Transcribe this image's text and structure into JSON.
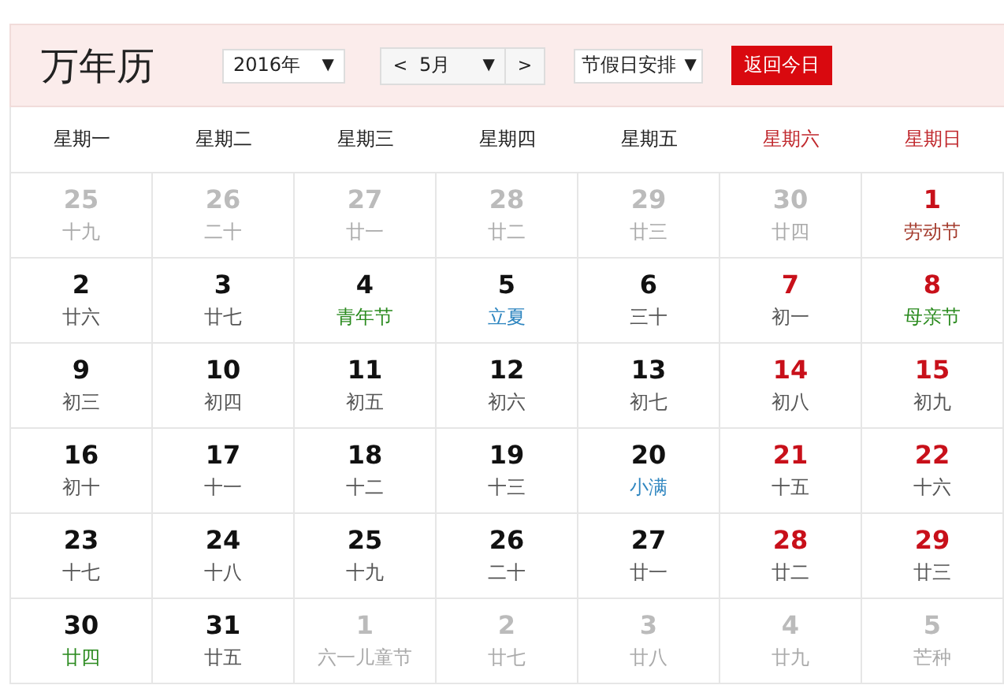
{
  "title": "万年历",
  "year_select": {
    "value": "2016年",
    "arrow": "▼"
  },
  "month_nav": {
    "prev": "<",
    "value": "5月",
    "arrow": "▼",
    "next": ">"
  },
  "holiday_select": {
    "value": "节假日安排",
    "arrow": "▼"
  },
  "today_button": "返回今日",
  "weekdays": [
    {
      "label": "星期一",
      "weekend": false
    },
    {
      "label": "星期二",
      "weekend": false
    },
    {
      "label": "星期三",
      "weekend": false
    },
    {
      "label": "星期四",
      "weekend": false
    },
    {
      "label": "星期五",
      "weekend": false
    },
    {
      "label": "星期六",
      "weekend": true
    },
    {
      "label": "星期日",
      "weekend": true
    }
  ],
  "weeks": [
    [
      {
        "day": "25",
        "kind": "other",
        "note": {
          "text": "十九",
          "color": "#aaaaaa"
        }
      },
      {
        "day": "26",
        "kind": "other",
        "note": {
          "text": "二十",
          "color": "#aaaaaa"
        }
      },
      {
        "day": "27",
        "kind": "other",
        "note": {
          "text": "廿一",
          "color": "#aaaaaa"
        }
      },
      {
        "day": "28",
        "kind": "other",
        "note": {
          "text": "廿二",
          "color": "#aaaaaa"
        }
      },
      {
        "day": "29",
        "kind": "other",
        "note": {
          "text": "廿三",
          "color": "#aaaaaa"
        }
      },
      {
        "day": "30",
        "kind": "other",
        "note": {
          "text": "廿四",
          "color": "#aaaaaa"
        }
      },
      {
        "day": "1",
        "kind": "weekend",
        "note": {
          "text": "劳动节",
          "color": "#a33a2c"
        }
      }
    ],
    [
      {
        "day": "2",
        "kind": "weekday",
        "note": {
          "text": "廿六",
          "color": "#555555"
        }
      },
      {
        "day": "3",
        "kind": "weekday",
        "note": {
          "text": "廿七",
          "color": "#555555"
        }
      },
      {
        "day": "4",
        "kind": "weekday",
        "note": {
          "text": "青年节",
          "color": "#2a8a1e"
        }
      },
      {
        "day": "5",
        "kind": "weekday",
        "note": {
          "text": "立夏",
          "color": "#2f86c0"
        }
      },
      {
        "day": "6",
        "kind": "weekday",
        "note": {
          "text": "三十",
          "color": "#555555"
        }
      },
      {
        "day": "7",
        "kind": "weekend",
        "note": {
          "text": "初一",
          "color": "#555555"
        }
      },
      {
        "day": "8",
        "kind": "weekend",
        "note": {
          "text": "母亲节",
          "color": "#2a8a1e"
        }
      }
    ],
    [
      {
        "day": "9",
        "kind": "weekday",
        "note": {
          "text": "初三",
          "color": "#555555"
        }
      },
      {
        "day": "10",
        "kind": "weekday",
        "note": {
          "text": "初四",
          "color": "#555555"
        }
      },
      {
        "day": "11",
        "kind": "weekday",
        "note": {
          "text": "初五",
          "color": "#555555"
        }
      },
      {
        "day": "12",
        "kind": "weekday",
        "note": {
          "text": "初六",
          "color": "#555555"
        }
      },
      {
        "day": "13",
        "kind": "weekday",
        "note": {
          "text": "初七",
          "color": "#555555"
        }
      },
      {
        "day": "14",
        "kind": "weekend",
        "note": {
          "text": "初八",
          "color": "#555555"
        }
      },
      {
        "day": "15",
        "kind": "weekend",
        "note": {
          "text": "初九",
          "color": "#555555"
        }
      }
    ],
    [
      {
        "day": "16",
        "kind": "weekday",
        "note": {
          "text": "初十",
          "color": "#555555"
        }
      },
      {
        "day": "17",
        "kind": "weekday",
        "note": {
          "text": "十一",
          "color": "#555555"
        }
      },
      {
        "day": "18",
        "kind": "weekday",
        "note": {
          "text": "十二",
          "color": "#555555"
        }
      },
      {
        "day": "19",
        "kind": "weekday",
        "note": {
          "text": "十三",
          "color": "#555555"
        }
      },
      {
        "day": "20",
        "kind": "weekday",
        "note": {
          "text": "小满",
          "color": "#2f86c0"
        }
      },
      {
        "day": "21",
        "kind": "weekend",
        "note": {
          "text": "十五",
          "color": "#555555"
        }
      },
      {
        "day": "22",
        "kind": "weekend",
        "note": {
          "text": "十六",
          "color": "#555555"
        }
      }
    ],
    [
      {
        "day": "23",
        "kind": "weekday",
        "note": {
          "text": "十七",
          "color": "#555555"
        }
      },
      {
        "day": "24",
        "kind": "weekday",
        "note": {
          "text": "十八",
          "color": "#555555"
        }
      },
      {
        "day": "25",
        "kind": "weekday",
        "note": {
          "text": "十九",
          "color": "#555555"
        }
      },
      {
        "day": "26",
        "kind": "weekday",
        "note": {
          "text": "二十",
          "color": "#555555"
        }
      },
      {
        "day": "27",
        "kind": "weekday",
        "note": {
          "text": "廿一",
          "color": "#555555"
        }
      },
      {
        "day": "28",
        "kind": "weekend",
        "note": {
          "text": "廿二",
          "color": "#555555"
        }
      },
      {
        "day": "29",
        "kind": "weekend",
        "note": {
          "text": "廿三",
          "color": "#555555"
        }
      }
    ],
    [
      {
        "day": "30",
        "kind": "weekday",
        "note": {
          "text": "廿四",
          "color": "#2a8a1e"
        }
      },
      {
        "day": "31",
        "kind": "weekday",
        "note": {
          "text": "廿五",
          "color": "#555555"
        }
      },
      {
        "day": "1",
        "kind": "other",
        "note": {
          "text": "六一儿童节",
          "color": "#aaaaaa"
        }
      },
      {
        "day": "2",
        "kind": "other",
        "note": {
          "text": "廿七",
          "color": "#aaaaaa"
        }
      },
      {
        "day": "3",
        "kind": "other",
        "note": {
          "text": "廿八",
          "color": "#aaaaaa"
        }
      },
      {
        "day": "4",
        "kind": "other",
        "note": {
          "text": "廿九",
          "color": "#aaaaaa"
        }
      },
      {
        "day": "5",
        "kind": "other",
        "note": {
          "text": "芒种",
          "color": "#aaaaaa"
        }
      }
    ]
  ]
}
